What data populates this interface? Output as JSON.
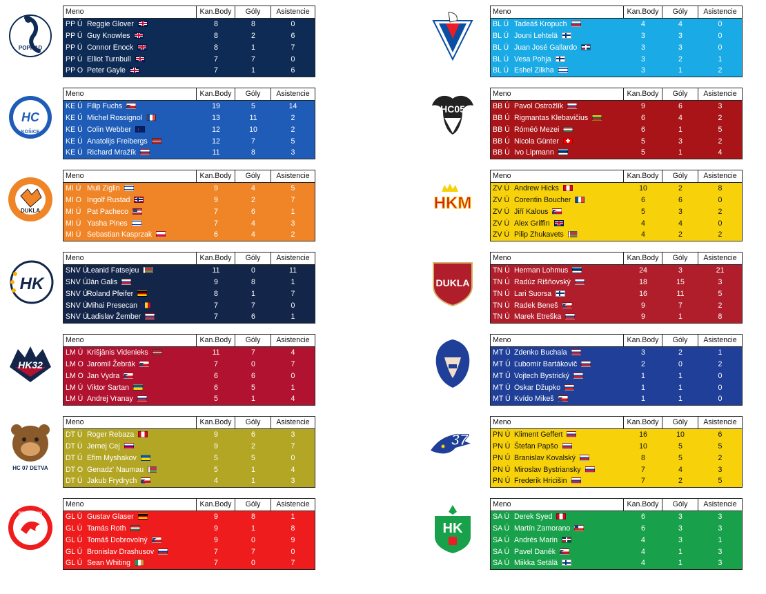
{
  "headers": {
    "name": "Meno",
    "points": "Kan.Body",
    "goals": "Góly",
    "assists": "Asistencie"
  },
  "teams": [
    {
      "id": "PP",
      "logo": "Kometa-style red-white logo",
      "color": "#0d2b55",
      "text_color": "#ffffff",
      "rows": [
        {
          "prefix": "PP Ú",
          "name": "Reggie Glover",
          "flag": "gb",
          "pts": "8",
          "g": "8",
          "a": "0"
        },
        {
          "prefix": "PP Ú",
          "name": "Guy Knowles",
          "flag": "gb",
          "pts": "8",
          "g": "2",
          "a": "6"
        },
        {
          "prefix": "PP Ú",
          "name": "Connor Enock",
          "flag": "gb",
          "pts": "8",
          "g": "1",
          "a": "7"
        },
        {
          "prefix": "PP Ú",
          "name": "Elliot Turnbull",
          "flag": "gb",
          "pts": "7",
          "g": "7",
          "a": "0"
        },
        {
          "prefix": "PP O",
          "name": "Peter Gayle",
          "flag": "gb",
          "pts": "7",
          "g": "1",
          "a": "6"
        }
      ]
    },
    {
      "id": "KE",
      "color": "#1e5cb8",
      "text_color": "#ffffff",
      "rows": [
        {
          "prefix": "KE Ú",
          "name": "Filip Fuchs",
          "flag": "cz",
          "pts": "19",
          "g": "5",
          "a": "14"
        },
        {
          "prefix": "KE Ú",
          "name": "Michel Rossignol",
          "flag": "fr",
          "pts": "13",
          "g": "11",
          "a": "2"
        },
        {
          "prefix": "KE Ú",
          "name": "Colin Webber",
          "flag": "nz",
          "pts": "12",
          "g": "10",
          "a": "2"
        },
        {
          "prefix": "KE Ú",
          "name": "Anatolijs Freibergs",
          "flag": "lv",
          "pts": "12",
          "g": "7",
          "a": "5"
        },
        {
          "prefix": "KE Ú",
          "name": "Richard Mražík",
          "flag": "sk",
          "pts": "11",
          "g": "8",
          "a": "3"
        }
      ]
    },
    {
      "id": "MI",
      "color": "#f08528",
      "text_color": "#ffffff",
      "rows": [
        {
          "prefix": "MI Ú",
          "name": "Muli Ziglin",
          "flag": "il",
          "pts": "9",
          "g": "4",
          "a": "5"
        },
        {
          "prefix": "MI O",
          "name": "Ingolf Rustad",
          "flag": "no",
          "pts": "9",
          "g": "2",
          "a": "7"
        },
        {
          "prefix": "MI Ú",
          "name": "Pat Pacheco",
          "flag": "us",
          "pts": "7",
          "g": "6",
          "a": "1"
        },
        {
          "prefix": "MI Ú",
          "name": "Yasha Pines",
          "flag": "il",
          "pts": "7",
          "g": "4",
          "a": "3"
        },
        {
          "prefix": "MI Ú",
          "name": "Sebastian Kasprzak",
          "flag": "pl",
          "pts": "6",
          "g": "4",
          "a": "2"
        }
      ]
    },
    {
      "id": "SNV",
      "color": "#132649",
      "text_color": "#ffffff",
      "rows": [
        {
          "prefix": "SNV Ú",
          "name": "Leanid Fatsejeu",
          "flag": "by",
          "pts": "11",
          "g": "0",
          "a": "11"
        },
        {
          "prefix": "SNV Ú",
          "name": "Ján Galis",
          "flag": "sk",
          "pts": "9",
          "g": "8",
          "a": "1"
        },
        {
          "prefix": "SNV Ú",
          "name": "Roland Pfeifer",
          "flag": "de",
          "pts": "8",
          "g": "1",
          "a": "7"
        },
        {
          "prefix": "SNV Ú",
          "name": "Mihai Presecan",
          "flag": "ro",
          "pts": "7",
          "g": "7",
          "a": "0"
        },
        {
          "prefix": "SNV Ú",
          "name": "Ladislav Žember",
          "flag": "sk",
          "pts": "7",
          "g": "6",
          "a": "1"
        }
      ]
    },
    {
      "id": "LM",
      "color": "#b0122f",
      "text_color": "#ffffff",
      "rows": [
        {
          "prefix": "LM Ú",
          "name": "Krišjānis Videnieks",
          "flag": "lv",
          "pts": "11",
          "g": "7",
          "a": "4"
        },
        {
          "prefix": "LM O",
          "name": "Jaromil Žebrák",
          "flag": "cz",
          "pts": "7",
          "g": "0",
          "a": "7"
        },
        {
          "prefix": "LM O",
          "name": "Jan Vydra",
          "flag": "cz",
          "pts": "6",
          "g": "6",
          "a": "0"
        },
        {
          "prefix": "LM Ú",
          "name": "Viktor Sartan",
          "flag": "ua",
          "pts": "6",
          "g": "5",
          "a": "1"
        },
        {
          "prefix": "LM Ú",
          "name": "Andrej Vranay",
          "flag": "sk",
          "pts": "5",
          "g": "1",
          "a": "4"
        }
      ]
    },
    {
      "id": "DT",
      "color": "#b3a625",
      "text_color": "#ffffff",
      "rows": [
        {
          "prefix": "DT Ú",
          "name": "Roger Rebaza",
          "flag": "ca",
          "pts": "9",
          "g": "6",
          "a": "3"
        },
        {
          "prefix": "DT Ú",
          "name": "Jernej Cej",
          "flag": "si",
          "pts": "9",
          "g": "2",
          "a": "7"
        },
        {
          "prefix": "DT Ú",
          "name": "Efim Myshakov",
          "flag": "ua",
          "pts": "5",
          "g": "5",
          "a": "0"
        },
        {
          "prefix": "DT O",
          "name": "Genadz' Naumau",
          "flag": "by",
          "pts": "5",
          "g": "1",
          "a": "4"
        },
        {
          "prefix": "DT Ú",
          "name": "Jakub Frydrych",
          "flag": "cz",
          "pts": "4",
          "g": "1",
          "a": "3"
        }
      ]
    },
    {
      "id": "GL",
      "color": "#ee1c1c",
      "text_color": "#ffffff",
      "rows": [
        {
          "prefix": "GL Ú",
          "name": "Gustav Glaser",
          "flag": "de",
          "pts": "9",
          "g": "8",
          "a": "1"
        },
        {
          "prefix": "GL Ú",
          "name": "Tamás Roth",
          "flag": "hu",
          "pts": "9",
          "g": "1",
          "a": "8"
        },
        {
          "prefix": "GL Ú",
          "name": "Tomáš Dobrovolný",
          "flag": "cz",
          "pts": "9",
          "g": "0",
          "a": "9"
        },
        {
          "prefix": "GL Ú",
          "name": "Bronislav Drashusov",
          "flag": "ru",
          "pts": "7",
          "g": "7",
          "a": "0"
        },
        {
          "prefix": "GL Ú",
          "name": "Sean Whiting",
          "flag": "ie",
          "pts": "7",
          "g": "0",
          "a": "7"
        }
      ]
    },
    {
      "id": "BL",
      "color": "#1aaae5",
      "text_color": "#ffffff",
      "rows": [
        {
          "prefix": "BL Ú",
          "name": "Tadeáš Kropuch",
          "flag": "sk",
          "pts": "4",
          "g": "4",
          "a": "0"
        },
        {
          "prefix": "BL Ú",
          "name": "Jouni Lehtelä",
          "flag": "fi",
          "pts": "3",
          "g": "3",
          "a": "0"
        },
        {
          "prefix": "BL Ú",
          "name": "Juan José Gallardo",
          "flag": "do",
          "pts": "3",
          "g": "3",
          "a": "0"
        },
        {
          "prefix": "BL Ú",
          "name": "Vesa Pohja",
          "flag": "fi",
          "pts": "3",
          "g": "2",
          "a": "1"
        },
        {
          "prefix": "BL Ú",
          "name": "Eshel Zilkha",
          "flag": "il",
          "pts": "3",
          "g": "1",
          "a": "2"
        }
      ]
    },
    {
      "id": "BB",
      "color": "#a81417",
      "text_color": "#ffffff",
      "rows": [
        {
          "prefix": "BB Ú",
          "name": "Pavol Ostrožlík",
          "flag": "sk",
          "pts": "9",
          "g": "6",
          "a": "3"
        },
        {
          "prefix": "BB Ú",
          "name": "Rigmantas Klebavičius",
          "flag": "lt",
          "pts": "6",
          "g": "4",
          "a": "2"
        },
        {
          "prefix": "BB Ú",
          "name": "Róméó Mezei",
          "flag": "hu",
          "pts": "6",
          "g": "1",
          "a": "5"
        },
        {
          "prefix": "BB Ú",
          "name": "Nicola Günter",
          "flag": "ch",
          "pts": "5",
          "g": "3",
          "a": "2"
        },
        {
          "prefix": "BB Ú",
          "name": "Ivo Lipmann",
          "flag": "ee",
          "pts": "5",
          "g": "1",
          "a": "4"
        }
      ]
    },
    {
      "id": "ZV",
      "color": "#f7d20b",
      "text_color": "#111111",
      "rows": [
        {
          "prefix": "ZV Ú",
          "name": "Andrew Hicks",
          "flag": "ca",
          "pts": "10",
          "g": "2",
          "a": "8"
        },
        {
          "prefix": "ZV Ú",
          "name": "Corentin Boucher",
          "flag": "fr",
          "pts": "6",
          "g": "6",
          "a": "0"
        },
        {
          "prefix": "ZV Ú",
          "name": "Jiří Kalous",
          "flag": "cz",
          "pts": "5",
          "g": "3",
          "a": "2"
        },
        {
          "prefix": "ZV Ú",
          "name": "Alex Griffin",
          "flag": "gb",
          "pts": "4",
          "g": "4",
          "a": "0"
        },
        {
          "prefix": "ZV Ú",
          "name": "Pilip Zhukavets",
          "flag": "by",
          "pts": "4",
          "g": "2",
          "a": "2"
        }
      ]
    },
    {
      "id": "TN",
      "color": "#b01e2b",
      "text_color": "#ffffff",
      "rows": [
        {
          "prefix": "TN Ú",
          "name": "Herman Lohmus",
          "flag": "ee",
          "pts": "24",
          "g": "3",
          "a": "21"
        },
        {
          "prefix": "TN Ú",
          "name": "Radúz Rišňovský",
          "flag": "sk",
          "pts": "18",
          "g": "15",
          "a": "3"
        },
        {
          "prefix": "TN Ú",
          "name": "Lari Suorsa",
          "flag": "fi",
          "pts": "16",
          "g": "11",
          "a": "5"
        },
        {
          "prefix": "TN Ú",
          "name": "Radek Beneš",
          "flag": "cz",
          "pts": "9",
          "g": "7",
          "a": "2"
        },
        {
          "prefix": "TN Ú",
          "name": "Marek Etreška",
          "flag": "sk",
          "pts": "9",
          "g": "1",
          "a": "8"
        }
      ]
    },
    {
      "id": "MT",
      "color": "#1f3f98",
      "text_color": "#ffffff",
      "rows": [
        {
          "prefix": "MT Ú",
          "name": "Zdenko Buchala",
          "flag": "sk",
          "pts": "3",
          "g": "2",
          "a": "1"
        },
        {
          "prefix": "MT Ú",
          "name": "Ľubomír Bartákovič",
          "flag": "sk",
          "pts": "2",
          "g": "0",
          "a": "2"
        },
        {
          "prefix": "MT Ú",
          "name": "Vojtech Bystrický",
          "flag": "sk",
          "pts": "1",
          "g": "1",
          "a": "0"
        },
        {
          "prefix": "MT Ú",
          "name": "Oskar Džupko",
          "flag": "sk",
          "pts": "1",
          "g": "1",
          "a": "0"
        },
        {
          "prefix": "MT Ú",
          "name": "Kvído Mikeš",
          "flag": "cz",
          "pts": "1",
          "g": "1",
          "a": "0"
        }
      ]
    },
    {
      "id": "PN",
      "color": "#f7d20b",
      "text_color": "#111111",
      "rows": [
        {
          "prefix": "PN Ú",
          "name": "Kliment Geffert",
          "flag": "sk",
          "pts": "16",
          "g": "10",
          "a": "6"
        },
        {
          "prefix": "PN Ú",
          "name": "Štefan Papšo",
          "flag": "sk",
          "pts": "10",
          "g": "5",
          "a": "5"
        },
        {
          "prefix": "PN Ú",
          "name": "Branislav Kovalský",
          "flag": "sk",
          "pts": "8",
          "g": "5",
          "a": "2"
        },
        {
          "prefix": "PN Ú",
          "name": "Miroslav Bystriansky",
          "flag": "sk",
          "pts": "7",
          "g": "4",
          "a": "3"
        },
        {
          "prefix": "PN Ú",
          "name": "Frederik Hricišin",
          "flag": "sk",
          "pts": "7",
          "g": "2",
          "a": "5"
        }
      ]
    },
    {
      "id": "SA",
      "color": "#18a14a",
      "text_color": "#ffffff",
      "rows": [
        {
          "prefix": "SA Ú",
          "name": "Derek Syed",
          "flag": "ca",
          "pts": "6",
          "g": "3",
          "a": "3"
        },
        {
          "prefix": "SA Ú",
          "name": "Martín Zamorano",
          "flag": "cl",
          "pts": "6",
          "g": "3",
          "a": "3"
        },
        {
          "prefix": "SA Ú",
          "name": "Andrés Marin",
          "flag": "do",
          "pts": "4",
          "g": "3",
          "a": "1"
        },
        {
          "prefix": "SA Ú",
          "name": "Pavel Daněk",
          "flag": "cz",
          "pts": "4",
          "g": "1",
          "a": "3"
        },
        {
          "prefix": "SA Ú",
          "name": "Miikka Setälä",
          "flag": "fi",
          "pts": "4",
          "g": "1",
          "a": "3"
        }
      ]
    }
  ],
  "logos": [
    {
      "team": "PP",
      "icon": "poprad-snake-logo",
      "text": "POPRAD"
    },
    {
      "team": "KE",
      "icon": "hockey-club-kosice-logo",
      "text": "KOŠICE"
    },
    {
      "team": "MI",
      "icon": "dukla-michalovce-fox-logo",
      "text": "DUKLA"
    },
    {
      "team": "SNV",
      "icon": "hk-spisska-nova-ves-logo",
      "text": "HK"
    },
    {
      "team": "LM",
      "icon": "hk-32-liptovsky-mikulas-logo",
      "text": "HK32"
    },
    {
      "team": "DT",
      "icon": "hc-07-detva-bear-logo",
      "text": "HC 07 DETVA"
    },
    {
      "team": "GL",
      "icon": "hc-rebellion-gelnica-logo",
      "text": "REBELLION"
    },
    {
      "team": "BL",
      "icon": "slovan-bratislava-eagle-logo",
      "text": ""
    },
    {
      "team": "BB",
      "icon": "hc-05-banska-bystrica-ram-logo",
      "text": "HC05"
    },
    {
      "team": "ZV",
      "icon": "hkm-zvolen-logo",
      "text": "HKM"
    },
    {
      "team": "TN",
      "icon": "dukla-trencin-logo",
      "text": "DUKLA"
    },
    {
      "team": "MT",
      "icon": "mhc-martin-knight-logo",
      "text": ""
    },
    {
      "team": "PN",
      "icon": "hk-37-piestany-crow-logo",
      "text": "37"
    },
    {
      "team": "SA",
      "icon": "hk-skalica-logo",
      "text": "HK"
    }
  ]
}
